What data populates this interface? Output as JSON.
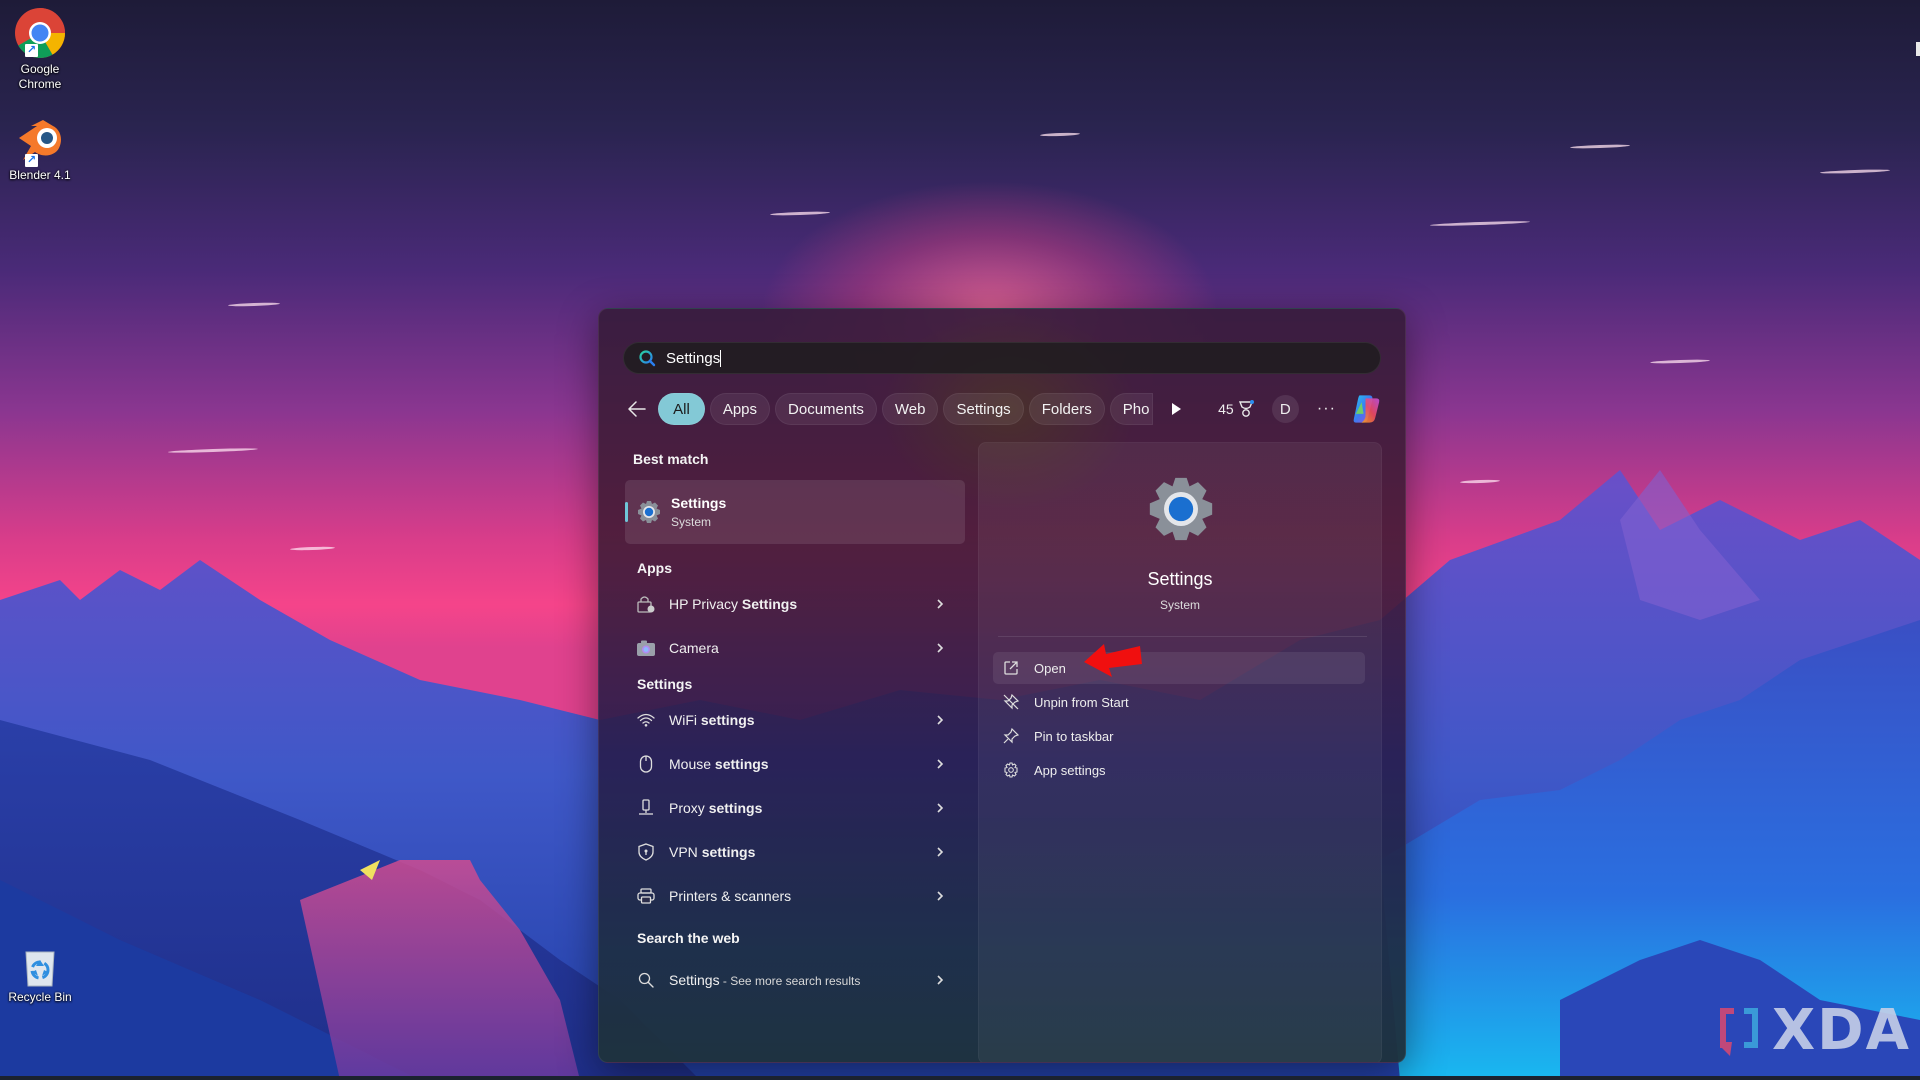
{
  "desktop": {
    "icons": [
      {
        "label": "Google Chrome",
        "icon": "chrome-icon"
      },
      {
        "label": "Blender 4.1",
        "icon": "blender-icon"
      },
      {
        "label": "Recycle Bin",
        "icon": "recycle-bin-icon"
      }
    ],
    "watermark": "XDA"
  },
  "search": {
    "query": "Settings",
    "icon": "search-icon"
  },
  "filters": {
    "back_icon": "arrow-left-icon",
    "tabs": [
      "All",
      "Apps",
      "Documents",
      "Web",
      "Settings",
      "Folders",
      "Pho"
    ],
    "active_tab": "All",
    "scroll_icon": "play-right-icon",
    "points": "45",
    "points_icon": "rewards-trophy-icon",
    "account_initial": "D",
    "more": "···",
    "copilot_icon": "copilot-icon"
  },
  "results": {
    "best_match": {
      "section": "Best match",
      "title": "Settings",
      "subtitle": "System",
      "icon": "settings-gear-icon"
    },
    "apps_section": "Apps",
    "apps": [
      {
        "prefix": "HP Privacy ",
        "bold": "Settings",
        "icon": "hp-privacy-lock-icon"
      },
      {
        "prefix": "Camera",
        "bold": "",
        "icon": "camera-icon"
      }
    ],
    "settings_section": "Settings",
    "settings": [
      {
        "prefix": "WiFi ",
        "bold": "settings",
        "icon": "wifi-icon"
      },
      {
        "prefix": "Mouse ",
        "bold": "settings",
        "icon": "mouse-icon"
      },
      {
        "prefix": "Proxy ",
        "bold": "settings",
        "icon": "proxy-icon"
      },
      {
        "prefix": "VPN ",
        "bold": "settings",
        "icon": "vpn-shield-icon"
      },
      {
        "prefix": "Printers & scanners",
        "bold": "",
        "icon": "printer-icon"
      }
    ],
    "web_section": "Search the web",
    "web": {
      "title": "Settings",
      "suffix": " - See more search results",
      "icon": "search-icon"
    }
  },
  "preview": {
    "title": "Settings",
    "subtitle": "System",
    "actions": [
      {
        "label": "Open",
        "icon": "open-external-icon"
      },
      {
        "label": "Unpin from Start",
        "icon": "unpin-icon"
      },
      {
        "label": "Pin to taskbar",
        "icon": "pin-icon"
      },
      {
        "label": "App settings",
        "icon": "gear-outline-icon"
      }
    ]
  },
  "colors": {
    "active_pill": "#83c9d6",
    "accent_bar": "#6fc6d8",
    "annotation_arrow": "#ff0000"
  }
}
